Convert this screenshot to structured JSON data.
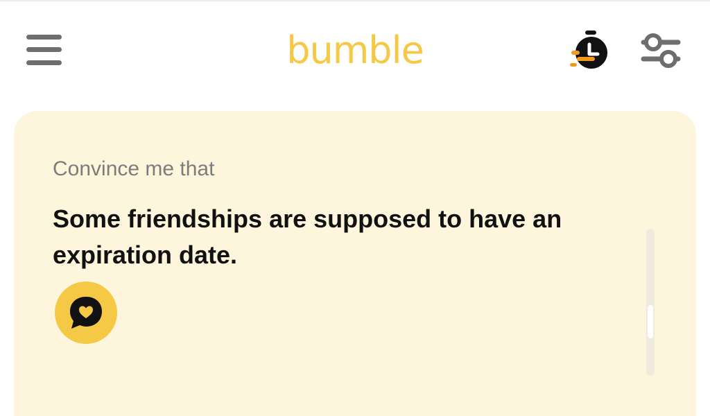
{
  "app": {
    "logo_text": "bumble"
  },
  "header": {
    "menu_icon": "hamburger-menu-icon",
    "timer_icon": "stopwatch-icon",
    "filter_icon": "sliders-filter-icon"
  },
  "prompt_card": {
    "label": "Convince me that",
    "text": "Some friendships are supposed to have an expiration date.",
    "comment_icon": "heart-speech-bubble-icon"
  },
  "colors": {
    "brand_yellow": "#f5c946",
    "card_background": "#fdf6dc",
    "icon_gray": "#6e6e6e",
    "timer_accent": "#f29a1f"
  }
}
